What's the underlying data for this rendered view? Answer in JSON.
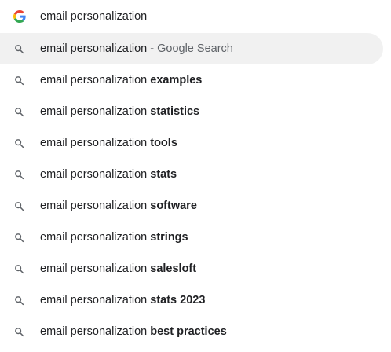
{
  "omnibox": {
    "query": "email personalization",
    "logo_icon": "google-g-icon",
    "colors": {
      "blue": "#4285F4",
      "red": "#EA4335",
      "yellow": "#FBBC05",
      "green": "#34A853",
      "selected_bg": "#f1f1f1",
      "secondary_text": "#5f6368"
    }
  },
  "suggestions": [
    {
      "prefix": "email personalization",
      "separator": " - ",
      "source": "Google Search",
      "icon": "search-icon",
      "selected": true
    },
    {
      "prefix": "email personalization ",
      "completion": "examples",
      "icon": "search-icon"
    },
    {
      "prefix": "email personalization ",
      "completion": "statistics",
      "icon": "search-icon"
    },
    {
      "prefix": "email personalization ",
      "completion": "tools",
      "icon": "search-icon"
    },
    {
      "prefix": "email personalization ",
      "completion": "stats",
      "icon": "search-icon"
    },
    {
      "prefix": "email personalization ",
      "completion": "software",
      "icon": "search-icon"
    },
    {
      "prefix": "email personalization ",
      "completion": "strings",
      "icon": "search-icon"
    },
    {
      "prefix": "email personalization ",
      "completion": "salesloft",
      "icon": "search-icon"
    },
    {
      "prefix": "email personalization ",
      "completion": "stats 2023",
      "icon": "search-icon"
    },
    {
      "prefix": "email personalization ",
      "completion": "best practices",
      "icon": "search-icon"
    }
  ]
}
